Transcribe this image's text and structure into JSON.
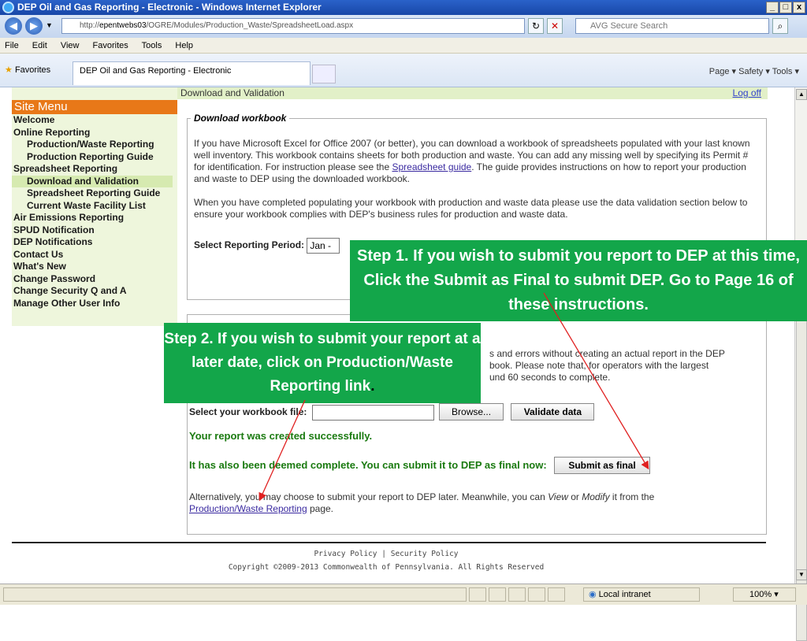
{
  "window": {
    "title": "DEP Oil and Gas Reporting - Electronic - Windows Internet Explorer",
    "url_prefix": "http://",
    "url_host": "epentwebs03",
    "url_path": "/OGRE/Modules/Production_Waste/SpreadsheetLoad.aspx",
    "search_placeholder": "AVG Secure Search",
    "menu": [
      "File",
      "Edit",
      "View",
      "Favorites",
      "Tools",
      "Help"
    ],
    "favorites_label": "Favorites",
    "tab_title": "DEP Oil and Gas Reporting - Electronic",
    "commands": "Page ▾   Safety ▾   Tools ▾",
    "status_zone": "Local intranet",
    "zoom": "100%"
  },
  "sidebar": {
    "header": "Site Menu",
    "items": [
      {
        "label": "Welcome",
        "level": 0
      },
      {
        "label": "Online Reporting",
        "level": 0
      },
      {
        "label": "Production/Waste Reporting",
        "level": 1
      },
      {
        "label": "Production Reporting Guide",
        "level": 1
      },
      {
        "label": "Spreadsheet Reporting",
        "level": 0
      },
      {
        "label": "Download and Validation",
        "level": 1,
        "selected": true
      },
      {
        "label": "Spreadsheet Reporting Guide",
        "level": 1
      },
      {
        "label": "Current Waste Facility List",
        "level": 1
      },
      {
        "label": "Air Emissions Reporting",
        "level": 0
      },
      {
        "label": "SPUD Notification",
        "level": 0
      },
      {
        "label": "DEP Notifications",
        "level": 0
      },
      {
        "label": "Contact Us",
        "level": 0
      },
      {
        "label": "What's New",
        "level": 0
      },
      {
        "label": "Change Password",
        "level": 0
      },
      {
        "label": "Change Security Q and A",
        "level": 0
      },
      {
        "label": "Manage Other User Info",
        "level": 0
      }
    ]
  },
  "page": {
    "breadcrumb": "Download and Validation",
    "logoff": "Log off",
    "download": {
      "legend": "Download workbook",
      "p1_before": "If you have Microsoft Excel for Office 2007 (or better), you can download a workbook of spreadsheets populated with your last known well inventory. This workbook contains sheets for both production and waste. You can add any missing well by specifying its Permit # for identification. For instruction please see the ",
      "p1_link": "Spreadsheet guide",
      "p1_after": ". The guide provides instructions on how to report your production and waste to DEP using the downloaded workbook.",
      "p2": "When you have completed populating your workbook with production and waste data please use the data validation section below to ensure your workbook complies with DEP's business rules for production and waste data.",
      "period_label": "Select Reporting Period:",
      "period_value": "Jan - "
    },
    "validate": {
      "text_line1": "s and errors without creating an actual report in the DEP",
      "text_line2": "book. Please note that, for operators with the largest",
      "text_line3": "und 60 seconds to complete.",
      "file_label": "Select your workbook file:",
      "browse": "Browse...",
      "validate_btn": "Validate data",
      "success": "Your report was created successfully.",
      "complete": "It has also been deemed complete. You can submit it to DEP as final now:",
      "submit_btn": "Submit as final",
      "alt_before": "Alternatively, you may choose to submit your report to DEP later. Meanwhile, you can ",
      "alt_view": "View",
      "alt_or": " or ",
      "alt_modify": "Modify",
      "alt_after": " it from the",
      "alt_link": "Production/Waste Reporting",
      "alt_end": " page."
    },
    "footer": {
      "privacy": "Privacy Policy",
      "sep": "|",
      "security": "Security Policy",
      "copyright": "Copyright ©2009-2013 Commonwealth of Pennsylvania. All Rights Reserved"
    }
  },
  "callouts": {
    "step1": "Step 1. If you wish to submit you report to DEP at this time, Click the Submit as Final to submit DEP. Go to Page 16 of these instructions.",
    "step2_main": "Step 2. If you wish to submit your report at a later date, click on Production/Waste Reporting link",
    "step2_end": "."
  },
  "colors": {
    "callout": "#13a64a",
    "menu_header": "#e87818",
    "arrow": "#e02020",
    "success_text": "#1a7a10"
  }
}
